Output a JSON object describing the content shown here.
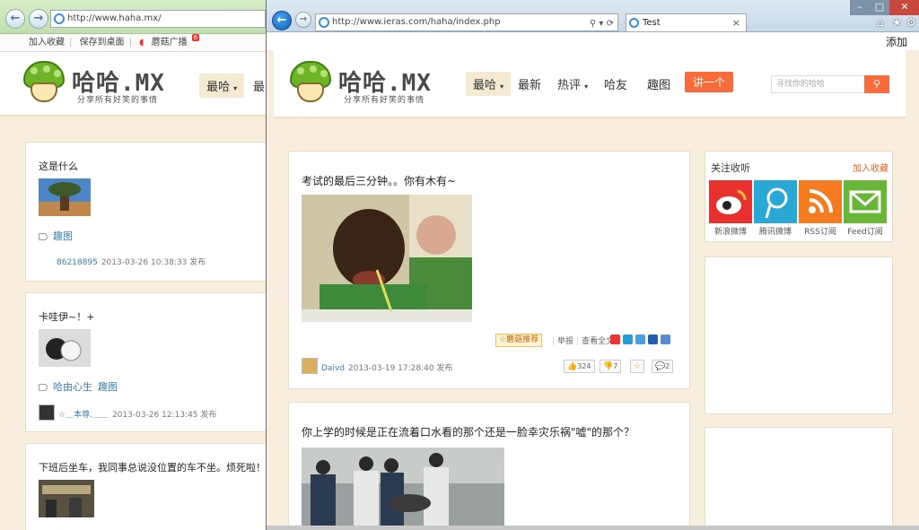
{
  "back_window": {
    "address": "http://www.haha.mx/",
    "favbar": {
      "add_fav": "加入收藏",
      "save_desktop": "保存到桌面",
      "mushroom_ad": "蘑菇广播",
      "badge": "6"
    },
    "logo_text": "哈哈.MX",
    "logo_sub": "分享所有好笑的事情",
    "nav": {
      "top": "最哈",
      "next_cut": "最"
    },
    "posts": [
      {
        "title": "这是什么",
        "tags": [
          "趣图"
        ],
        "user": "86218895",
        "time": "2013-03-26 10:38:33",
        "posted": "发布"
      },
      {
        "title": "卡哇伊~！+",
        "tags": [
          "哈由心生",
          "趣图"
        ],
        "user": "☆＿本尊.＿＿",
        "time": "2013-03-26 12:13:45",
        "posted": "发布"
      },
      {
        "title": "下班后坐车，我同事总说没位置的车不坐。烦死啦！"
      }
    ]
  },
  "front_window": {
    "address": "http://www.ieras.com/haha/index.php",
    "tab_title": "Test",
    "cmd_add": "添加",
    "logo_text": "哈哈.MX",
    "logo_sub": "分享所有好笑的事情",
    "nav": [
      {
        "label": "最哈",
        "dropdown": true,
        "active": true
      },
      {
        "label": "最新"
      },
      {
        "label": "热评",
        "dropdown": true
      },
      {
        "label": "哈友"
      },
      {
        "label": "趣图"
      }
    ],
    "post_button": "讲一个",
    "search_placeholder": "寻找你的哈哈",
    "posts": [
      {
        "title": "考试的最后三分钟。。你有木有~",
        "recommend": "☆蘑菇推荐",
        "report": "举报",
        "view_full": "查看全文",
        "user": "Daivd",
        "time": "2013-03-19 17:28:40",
        "posted": "发布",
        "likes": "324",
        "dislikes": "7",
        "comments": "2"
      },
      {
        "title": "你上学的时候是正在流着口水看的那个还是一脸幸灾乐祸\"嘘\"的那个？"
      }
    ],
    "sidebar": {
      "follow_title": "关注收听",
      "add_fav": "加入收藏",
      "follows": [
        {
          "label": "新浪微博",
          "color": "#e8312f"
        },
        {
          "label": "腾讯微博",
          "color": "#29a8d6"
        },
        {
          "label": "RSS订阅",
          "color": "#f47b20"
        },
        {
          "label": "Feed订阅",
          "color": "#68b636"
        }
      ]
    }
  }
}
